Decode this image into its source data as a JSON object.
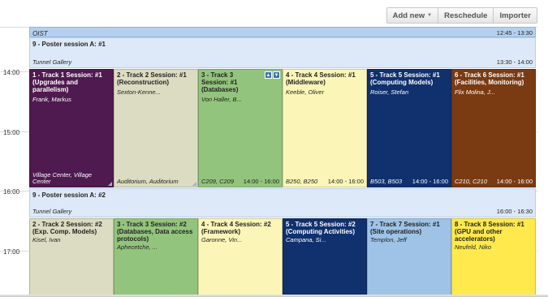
{
  "toolbar": {
    "add_new": "Add new",
    "reschedule": "Reschedule",
    "importer": "Importer"
  },
  "hours": [
    "14:00",
    "15:00",
    "16:00",
    "17:00"
  ],
  "full_blocks": {
    "oist": {
      "title": "OIST",
      "time": "12:45 - 13:30"
    },
    "poster_a1": {
      "title": "9 - Poster session A: #1",
      "location": "Tunnel Gallery",
      "time": "13:30 - 14:00"
    },
    "poster_a2": {
      "title": "9 - Poster session A: #2",
      "location": "Tunnel Gallery",
      "time": "16:00 - 16:30"
    }
  },
  "tracks_row1": [
    {
      "title": "1 - Track 1 Session: #1 (Upgrades and parallelism)",
      "convener": "Frank, Markus",
      "location": "Village Center, Village Center",
      "time": "",
      "color": "#4f1a4f"
    },
    {
      "title": "2 - Track 2 Session: #1 (Reconstruction)",
      "convener": "Sexton-Kenne...",
      "location": "Auditorium, Auditorium",
      "time": "",
      "color": "#dcdcc2"
    },
    {
      "title": "3 - Track 3 Session: #1 (Databases)",
      "convener": "Von Haller, B...",
      "location": "C209, C209",
      "time": "14:00 - 16:00",
      "color": "#93c47d"
    },
    {
      "title": "4 - Track 4 Session: #1 (Middleware)",
      "convener": "Keeble, Oliver",
      "location": "B250, B250",
      "time": "14:00 - 16:00",
      "color": "#fbf6b8"
    },
    {
      "title": "5 - Track 5 Session: #1 (Computing Models)",
      "convener": "Roiser, Stefan",
      "location": "B503, B503",
      "time": "14:00 - 16:00",
      "color": "#10306e"
    },
    {
      "title": "6 - Track 6 Session: #1 (Facilities, Monitoring)",
      "convener": "Flix Molina, J...",
      "location": "C210, C210",
      "time": "14:00 - 16:00",
      "color": "#7a3a12"
    }
  ],
  "tracks_row2": [
    {
      "title": "2 - Track 2 Session: #2 (Exp. Comp. Models)",
      "convener": "Kisel, Ivan",
      "color": "#dcdcc2"
    },
    {
      "title": "3 - Track 3 Session: #2 (Databases, Data access protocols)",
      "convener": "Aphecetche, ...",
      "color": "#93c47d"
    },
    {
      "title": "4 - Track 4 Session: #2 (Framework)",
      "convener": "Garonne, Vin...",
      "color": "#fbf6b8"
    },
    {
      "title": "5 - Track 5 Session: #2 (Computing Activities)",
      "convener": "Campana, Si...",
      "color": "#10306e"
    },
    {
      "title": "7 - Track 7 Session: #1 (Site operations)",
      "convener": "Templon, Jeff",
      "color": "#9ec3e6"
    },
    {
      "title": "8 - Track 8 Session: #1 (GPU and other accelerators)",
      "convener": "Neufeld, Niko",
      "color": "#ffe94d"
    }
  ]
}
